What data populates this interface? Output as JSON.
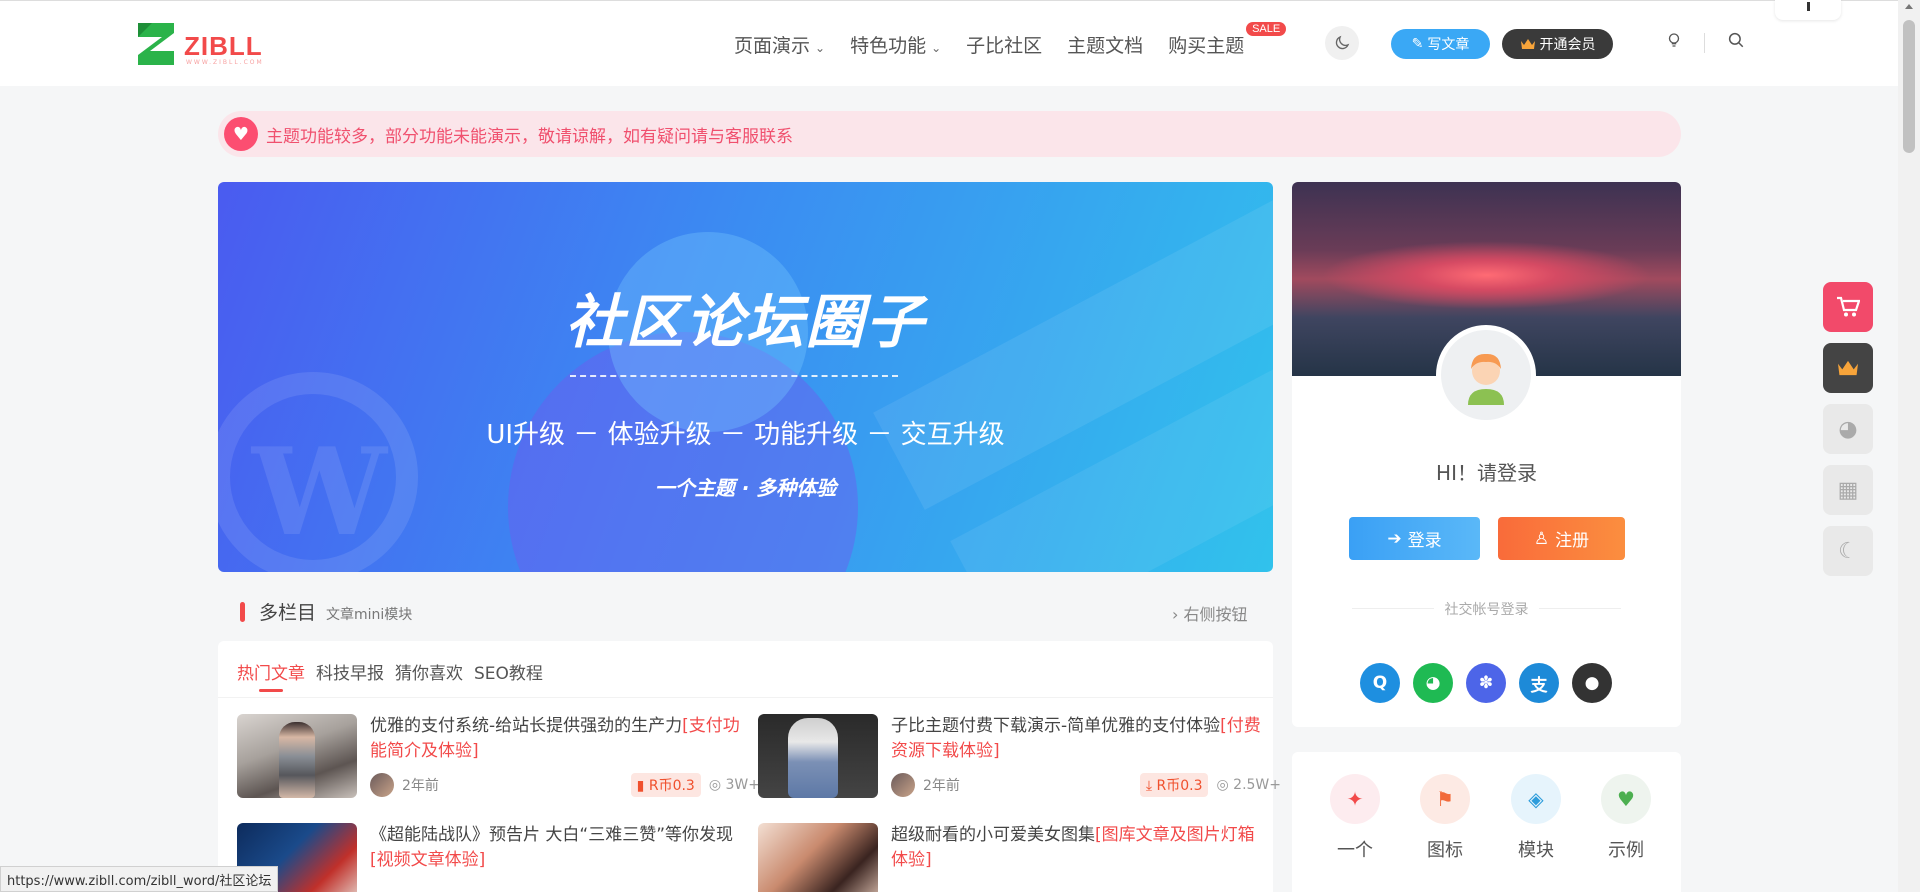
{
  "header": {
    "logo_text": "ZIBLL",
    "logo_sub": "WWW.ZIBLL.COM",
    "nav": [
      {
        "label": "页面演示",
        "dropdown": true
      },
      {
        "label": "特色功能",
        "dropdown": true
      },
      {
        "label": "子比社区",
        "dropdown": false
      },
      {
        "label": "主题文档",
        "dropdown": false
      },
      {
        "label": "购买主题",
        "dropdown": false,
        "badge": "SALE"
      }
    ],
    "write_label": "写文章",
    "vip_label": "开通会员"
  },
  "notice": {
    "text": "主题功能较多，部分功能未能演示，敬请谅解，如有疑问请与客服联系"
  },
  "banner": {
    "title": "社区论坛圈子",
    "subtitle": "UI升级 － 体验升级 － 功能升级 － 交互升级",
    "tagline": "一个主题 · 多种体验"
  },
  "section": {
    "title": "多栏目",
    "subtitle": "文章mini模块",
    "right_link": "右侧按钮",
    "tabs": [
      "热门文章",
      "科技早报",
      "猜你喜欢",
      "SEO教程"
    ]
  },
  "posts": [
    {
      "title": "优雅的支付系统-给站长提供强劲的生产力",
      "tag": "[支付功能简介及体验]",
      "time": "2年前",
      "price": "R币0.3",
      "price_icon": "book-icon",
      "views": "3W+"
    },
    {
      "title": "子比主题付费下载演示-简单优雅的支付体验",
      "tag": "[付费资源下载体验]",
      "time": "2年前",
      "price": "R币0.3",
      "price_icon": "download-icon",
      "views": "2.5W+"
    },
    {
      "title": "《超能陆战队》预告片 大白“三难三赞”等你发现",
      "tag": "[视频文章体验]",
      "time": "",
      "price": "",
      "views": ""
    },
    {
      "title": "超级耐看的小可爱美女图集",
      "tag": "[图库文章及图片灯箱体验]",
      "time": "",
      "price": "",
      "views": ""
    }
  ],
  "sidebar": {
    "greeting": "HI！请登录",
    "login_label": "登录",
    "register_label": "注册",
    "social_title": "社交帐号登录",
    "social": [
      {
        "name": "qq-icon",
        "color": "#1e8fe0"
      },
      {
        "name": "wechat-icon",
        "color": "#1fba53"
      },
      {
        "name": "baidu-icon",
        "color": "#4d65e8"
      },
      {
        "name": "alipay-icon",
        "color": "#1d8ad8"
      },
      {
        "name": "github-icon",
        "color": "#333333"
      }
    ],
    "shortcuts": [
      {
        "label": "一个",
        "icon": "magic-wand-icon",
        "color": "#f24a4a",
        "bg": "#fdecef"
      },
      {
        "label": "图标",
        "icon": "flag-icon",
        "color": "#f26a3a",
        "bg": "#fdeae4"
      },
      {
        "label": "模块",
        "icon": "cube-icon",
        "color": "#2d9cdb",
        "bg": "#e6f4fc"
      },
      {
        "label": "示例",
        "icon": "heartbeat-icon",
        "color": "#4caf50",
        "bg": "#eef4ee"
      }
    ]
  },
  "float_bar": [
    {
      "icon": "cart-icon",
      "color": "#f24a6a"
    },
    {
      "icon": "crown-icon",
      "color": "#444444"
    },
    {
      "icon": "wechat-icon",
      "color": "#e9e9e9"
    },
    {
      "icon": "qrcode-icon",
      "color": "#e9e9e9"
    },
    {
      "icon": "moon-icon",
      "color": "#e9e9e9"
    }
  ],
  "status_url": "https://www.zibll.com/zibll_word/社区论坛",
  "colors": {
    "accent": "#f24a4a",
    "brand_green": "#2bb34a",
    "blue": "#3aa8f5"
  }
}
